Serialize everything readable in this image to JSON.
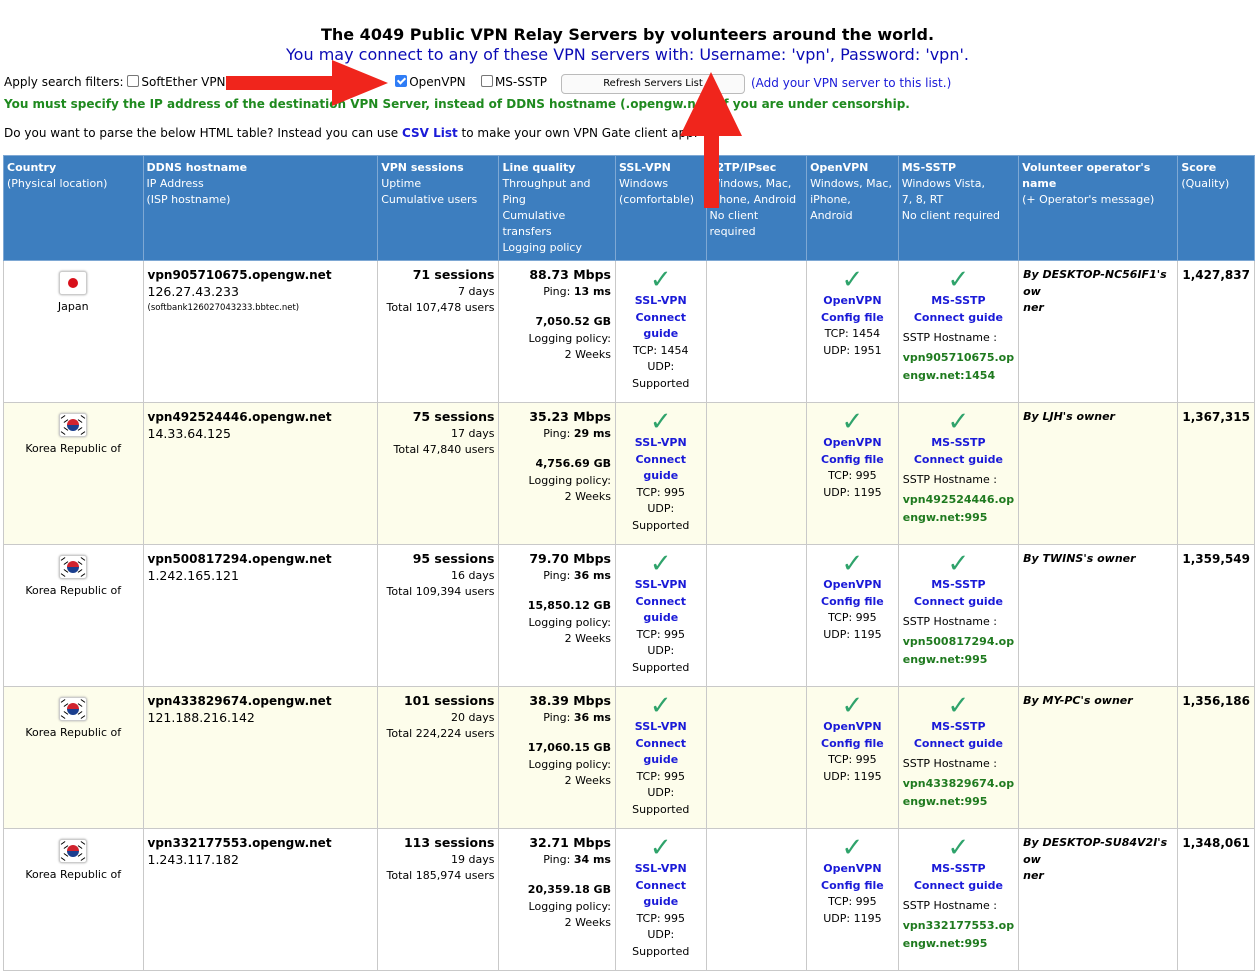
{
  "header": {
    "title": "The 4049 Public VPN Relay Servers by volunteers around the world.",
    "subtitle": "You may connect to any of these VPN servers with: Username: 'vpn', Password: 'vpn'."
  },
  "filters": {
    "label": "Apply search filters:",
    "softether": "SoftEther VPN",
    "openvpn": "OpenVPN",
    "mssstp": "MS-SSTP",
    "refresh": "Refresh Servers List",
    "add_link": "(Add your VPN server to this list.)"
  },
  "warning": "You must specify the IP address of the destination VPN Server, instead of DDNS hostname (.opengw.net) if you are under censorship.",
  "parse": {
    "pre": "Do you want to parse the below HTML table? Instead you can use",
    "link": "CSV List",
    "post": "to make your own VPN Gate client app."
  },
  "columns": {
    "country": [
      "Country",
      "(Physical location)"
    ],
    "ddns": [
      "DDNS hostname",
      "IP Address",
      "(ISP hostname)"
    ],
    "sessions": [
      "VPN sessions",
      "Uptime",
      "Cumulative users"
    ],
    "line": [
      "Line quality",
      "Throughput and Ping",
      "Cumulative transfers",
      "Logging policy"
    ],
    "ssl": [
      "SSL-VPN",
      "Windows",
      "(comfortable)"
    ],
    "l2tp": [
      "L2TP/IPsec",
      "Windows, Mac,",
      "iPhone, Android",
      "No client required"
    ],
    "openvpn": [
      "OpenVPN",
      "Windows, Mac,",
      "iPhone, Android"
    ],
    "sstp": [
      "MS-SSTP",
      "Windows Vista,",
      "7, 8, RT",
      "No client required"
    ],
    "operator": [
      "Volunteer operator's name",
      "(+ Operator's message)"
    ],
    "score": [
      "Score",
      "(Quality)"
    ]
  },
  "common": {
    "ssl_vpn": "SSL-VPN",
    "connect_guide": "Connect guide",
    "openvpn": "OpenVPN",
    "config_file": "Config file",
    "ms_sstp": "MS-SSTP",
    "sstp_hostname": "SSTP Hostname :",
    "ping_label": "Ping:",
    "logging_label": "Logging policy:",
    "logging_value": "2 Weeks",
    "udp_supported": "UDP: Supported"
  },
  "rows": [
    {
      "country": "Japan",
      "flag": "jp",
      "ddns": "vpn905710675.opengw.net",
      "ip": "126.27.43.233",
      "isp": "(softbank126027043233.bbtec.net)",
      "sessions": "71 sessions",
      "uptime": "7 days",
      "users": "Total 107,478 users",
      "throughput": "88.73 Mbps",
      "ping": "13 ms",
      "transfer": "7,050.52 GB",
      "ssl_tcp": "TCP: 1454",
      "ovpn_tcp": "TCP: 1454",
      "ovpn_udp": "UDP: 1951",
      "sstp_host_1": "vpn905710675.op",
      "sstp_host_2": "engw.net:1454",
      "operator_1": "By DESKTOP-NC56IF1's ow",
      "operator_2": "ner",
      "score": "1,427,837"
    },
    {
      "country": "Korea Republic of",
      "flag": "kr",
      "ddns": "vpn492524446.opengw.net",
      "ip": "14.33.64.125",
      "isp": "",
      "sessions": "75 sessions",
      "uptime": "17 days",
      "users": "Total 47,840 users",
      "throughput": "35.23 Mbps",
      "ping": "29 ms",
      "transfer": "4,756.69 GB",
      "ssl_tcp": "TCP: 995",
      "ovpn_tcp": "TCP: 995",
      "ovpn_udp": "UDP: 1195",
      "sstp_host_1": "vpn492524446.op",
      "sstp_host_2": "engw.net:995",
      "operator_1": "By LJH's owner",
      "operator_2": "",
      "score": "1,367,315"
    },
    {
      "country": "Korea Republic of",
      "flag": "kr",
      "ddns": "vpn500817294.opengw.net",
      "ip": "1.242.165.121",
      "isp": "",
      "sessions": "95 sessions",
      "uptime": "16 days",
      "users": "Total 109,394 users",
      "throughput": "79.70 Mbps",
      "ping": "36 ms",
      "transfer": "15,850.12 GB",
      "ssl_tcp": "TCP: 995",
      "ovpn_tcp": "TCP: 995",
      "ovpn_udp": "UDP: 1195",
      "sstp_host_1": "vpn500817294.op",
      "sstp_host_2": "engw.net:995",
      "operator_1": "By TWINS's owner",
      "operator_2": "",
      "score": "1,359,549"
    },
    {
      "country": "Korea Republic of",
      "flag": "kr",
      "ddns": "vpn433829674.opengw.net",
      "ip": "121.188.216.142",
      "isp": "",
      "sessions": "101 sessions",
      "uptime": "20 days",
      "users": "Total 224,224 users",
      "throughput": "38.39 Mbps",
      "ping": "36 ms",
      "transfer": "17,060.15 GB",
      "ssl_tcp": "TCP: 995",
      "ovpn_tcp": "TCP: 995",
      "ovpn_udp": "UDP: 1195",
      "sstp_host_1": "vpn433829674.op",
      "sstp_host_2": "engw.net:995",
      "operator_1": "By MY-PC's owner",
      "operator_2": "",
      "score": "1,356,186"
    },
    {
      "country": "Korea Republic of",
      "flag": "kr",
      "ddns": "vpn332177553.opengw.net",
      "ip": "1.243.117.182",
      "isp": "",
      "sessions": "113 sessions",
      "uptime": "19 days",
      "users": "Total 185,974 users",
      "throughput": "32.71 Mbps",
      "ping": "34 ms",
      "transfer": "20,359.18 GB",
      "ssl_tcp": "TCP: 995",
      "ovpn_tcp": "TCP: 995",
      "ovpn_udp": "UDP: 1195",
      "sstp_host_1": "vpn332177553.op",
      "sstp_host_2": "engw.net:995",
      "operator_1": "By DESKTOP-SU84V2I's ow",
      "operator_2": "ner",
      "score": "1,348,061"
    }
  ]
}
